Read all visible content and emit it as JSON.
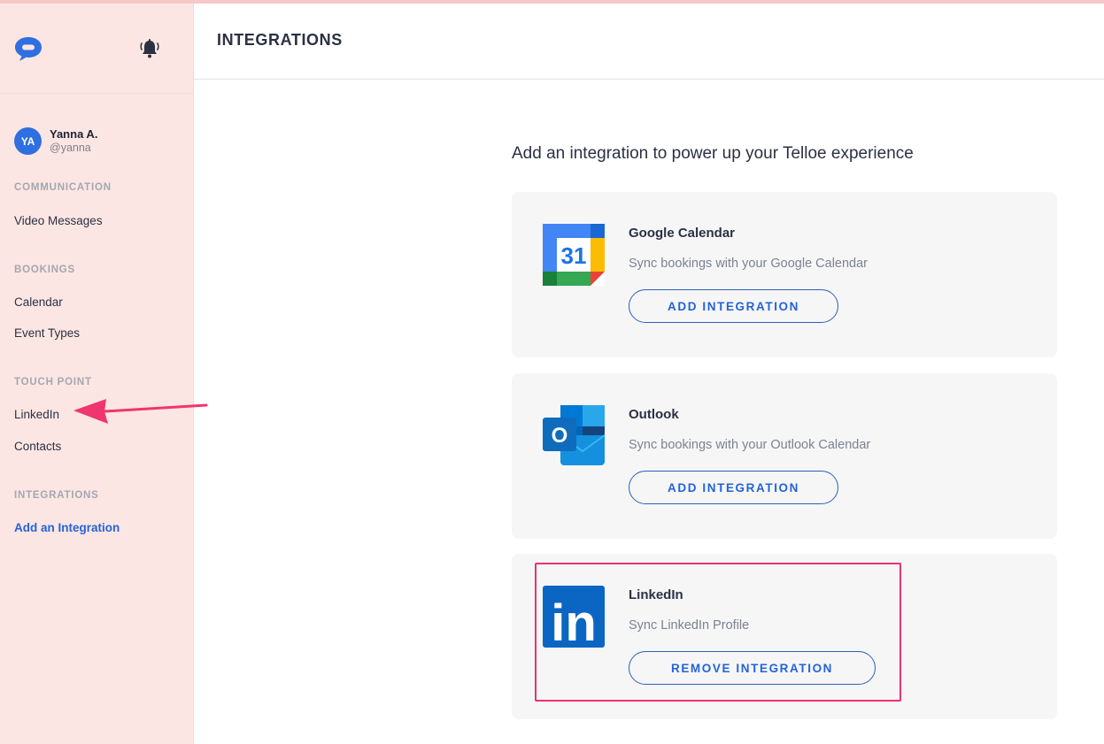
{
  "sidebar": {
    "user": {
      "initials": "YA",
      "name": "Yanna A.",
      "handle": "@yanna"
    },
    "sections": [
      {
        "title": "COMMUNICATION",
        "items": [
          {
            "label": "Video Messages"
          }
        ]
      },
      {
        "title": "BOOKINGS",
        "items": [
          {
            "label": "Calendar"
          },
          {
            "label": "Event Types"
          }
        ]
      },
      {
        "title": "TOUCH POINT",
        "items": [
          {
            "label": "LinkedIn"
          },
          {
            "label": "Contacts"
          }
        ]
      },
      {
        "title": "INTEGRATIONS",
        "items": [
          {
            "label": "Add an Integration",
            "active": true
          }
        ]
      }
    ]
  },
  "header": {
    "title": "INTEGRATIONS"
  },
  "main": {
    "intro": "Add an integration to power up your Telloe experience",
    "integrations": [
      {
        "name": "Google Calendar",
        "description": "Sync bookings with your Google Calendar",
        "button": "ADD INTEGRATION",
        "icon": "google-calendar-icon"
      },
      {
        "name": "Outlook",
        "description": "Sync bookings with your Outlook Calendar",
        "button": "ADD INTEGRATION",
        "icon": "outlook-icon"
      },
      {
        "name": "LinkedIn",
        "description": "Sync LinkedIn Profile",
        "button": "REMOVE INTEGRATION",
        "icon": "linkedin-icon"
      }
    ],
    "google_calendar_day": "31",
    "outlook_letter": "O",
    "linkedin_letters": "in"
  },
  "colors": {
    "sidebar_bg": "#fce6e3",
    "accent": "#2463d6",
    "annotation": "#e8336b"
  }
}
